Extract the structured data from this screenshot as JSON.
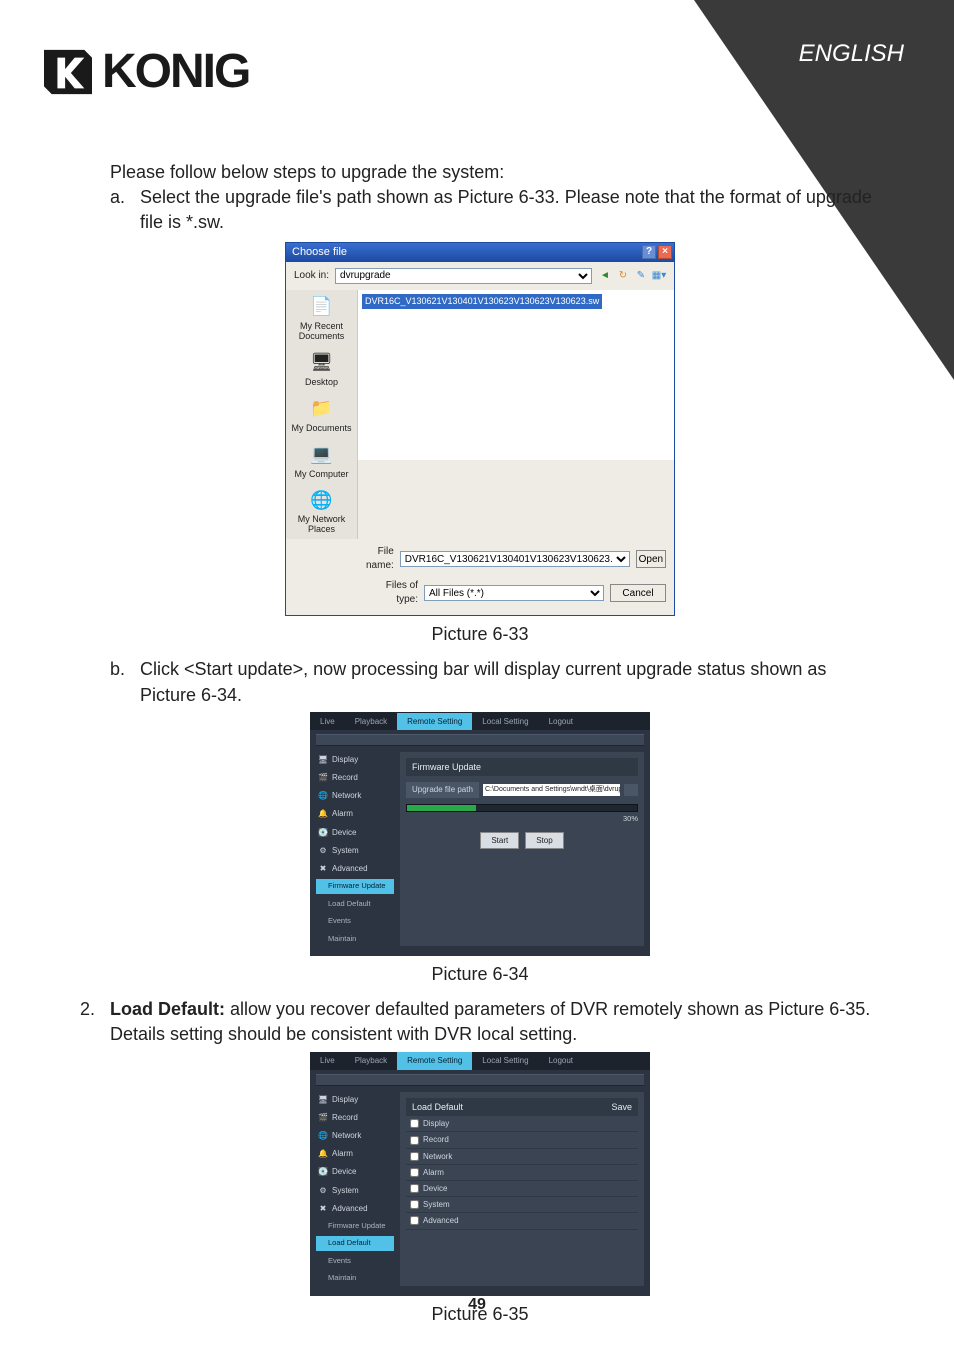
{
  "header": {
    "language": "ENGLISH",
    "brand": "KONIG"
  },
  "body": {
    "intro": "Please follow below steps to upgrade the system:",
    "step_a_marker": "a.",
    "step_a": "Select the upgrade file's path shown as Picture 6-33. Please note that the format of upgrade file is *.sw.",
    "caption_633": "Picture 6-33",
    "step_b_marker": "b.",
    "step_b": "Click <Start update>, now processing bar will display current upgrade status shown as Picture 6-34.",
    "caption_634": "Picture 6-34",
    "num2_marker": "2.",
    "load_default_label": "Load Default:",
    "load_default_rest": " allow you recover defaulted parameters of DVR remotely shown as Picture 6-35. Details setting should be consistent with DVR local setting.",
    "caption_635": "Picture 6-35",
    "page_number": "49"
  },
  "file_dialog": {
    "title": "Choose file",
    "look_in_label": "Look in:",
    "look_in_value": "dvrupgrade",
    "selected_file": "DVR16C_V130621V130401V130623V130623V130623.sw",
    "places": [
      "My Recent Documents",
      "Desktop",
      "My Documents",
      "My Computer",
      "My Network Places"
    ],
    "file_name_label": "File name:",
    "file_name_value": "DVR16C_V130621V130401V130623V130623.",
    "file_type_label": "Files of type:",
    "file_type_value": "All Files (*.*)",
    "open": "Open",
    "cancel": "Cancel"
  },
  "dvr_common": {
    "tabs": [
      "Live",
      "Playback",
      "Remote Setting",
      "Local Setting",
      "Logout"
    ],
    "nav": [
      "Display",
      "Record",
      "Network",
      "Alarm",
      "Device",
      "System",
      "Advanced"
    ],
    "advanced_sub": [
      "Firmware Update",
      "Load Default",
      "Events",
      "Maintain"
    ]
  },
  "firmware_panel": {
    "title": "Firmware Update",
    "upgrade_path_label": "Upgrade file path",
    "upgrade_path_value": "C:\\Documents and Settings\\wndt\\桌面\\dvrupgrade\\D",
    "progress_pct": "30%",
    "progress_width": "30%",
    "start": "Start",
    "stop": "Stop"
  },
  "load_default_panel": {
    "title": "Load Default",
    "save": "Save",
    "items": [
      "Display",
      "Record",
      "Network",
      "Alarm",
      "Device",
      "System",
      "Advanced"
    ]
  }
}
